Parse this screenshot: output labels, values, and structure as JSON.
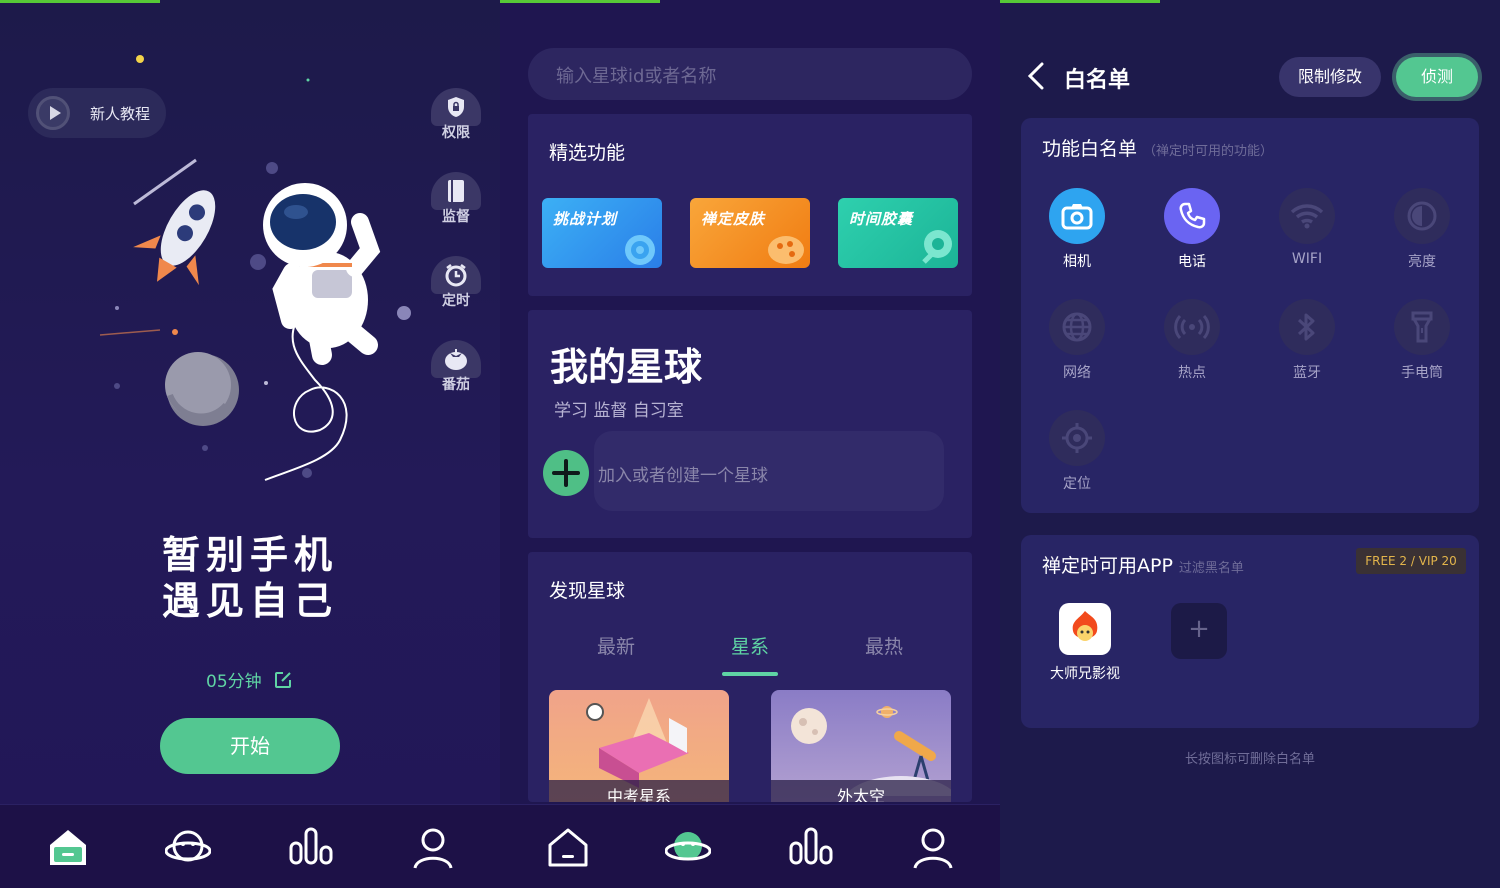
{
  "screen1": {
    "tutorial_label": "新人教程",
    "side_buttons": [
      {
        "label": "权限",
        "icon": "lock-icon"
      },
      {
        "label": "监督",
        "icon": "book-icon"
      },
      {
        "label": "定时",
        "icon": "alarm-clock-icon"
      },
      {
        "label": "番茄",
        "icon": "tomato-icon"
      }
    ],
    "slogan_line1": "暂别手机",
    "slogan_line2": "遇见自己",
    "timer": "05分钟",
    "start_label": "开始"
  },
  "screen2": {
    "search_placeholder": "输入星球id或者名称",
    "featured_title": "精选功能",
    "features": [
      {
        "label": "挑战计划",
        "color": "#3aa3f0"
      },
      {
        "label": "禅定皮肤",
        "color": "#f7961e"
      },
      {
        "label": "时间胶囊",
        "color": "#26c4a3"
      }
    ],
    "my_planet_title": "我的星球",
    "my_planet_sub": "学习 监督 自习室",
    "join_label": "加入或者创建一个星球",
    "discover_title": "发现星球",
    "tabs": [
      "最新",
      "星系",
      "最热"
    ],
    "active_tab": "星系",
    "planets": [
      {
        "label": "中考星系"
      },
      {
        "label": "外太空"
      }
    ]
  },
  "screen3": {
    "title": "白名单",
    "restrict_label": "限制修改",
    "detect_label": "侦测",
    "functions_title": "功能白名单",
    "functions_sub": "（禅定时可用的功能）",
    "functions": [
      {
        "label": "相机",
        "icon": "camera-icon",
        "active": true,
        "color": "#2ea4f0"
      },
      {
        "label": "电话",
        "icon": "phone-icon",
        "active": true,
        "color": "#6a64f2"
      },
      {
        "label": "WIFI",
        "icon": "wifi-icon",
        "active": false
      },
      {
        "label": "亮度",
        "icon": "brightness-icon",
        "active": false
      },
      {
        "label": "网络",
        "icon": "globe-icon",
        "active": false
      },
      {
        "label": "热点",
        "icon": "hotspot-icon",
        "active": false
      },
      {
        "label": "蓝牙",
        "icon": "bluetooth-icon",
        "active": false
      },
      {
        "label": "手电筒",
        "icon": "flashlight-icon",
        "active": false
      },
      {
        "label": "定位",
        "icon": "location-icon",
        "active": false
      }
    ],
    "apps_title": "禅定时可用APP",
    "apps_sub": "过滤黑名单",
    "apps_quota": "FREE 2 / VIP 20",
    "apps": [
      {
        "label": "大师兄影视",
        "icon": "monkey-app-icon"
      }
    ],
    "hint": "长按图标可删除白名单"
  },
  "bottom_nav": [
    "home-icon",
    "planet-icon",
    "stats-icon",
    "profile-icon"
  ],
  "colors": {
    "accent_green": "#53c791",
    "background": "#1f1650",
    "active_tab": "#5fd4a4"
  }
}
